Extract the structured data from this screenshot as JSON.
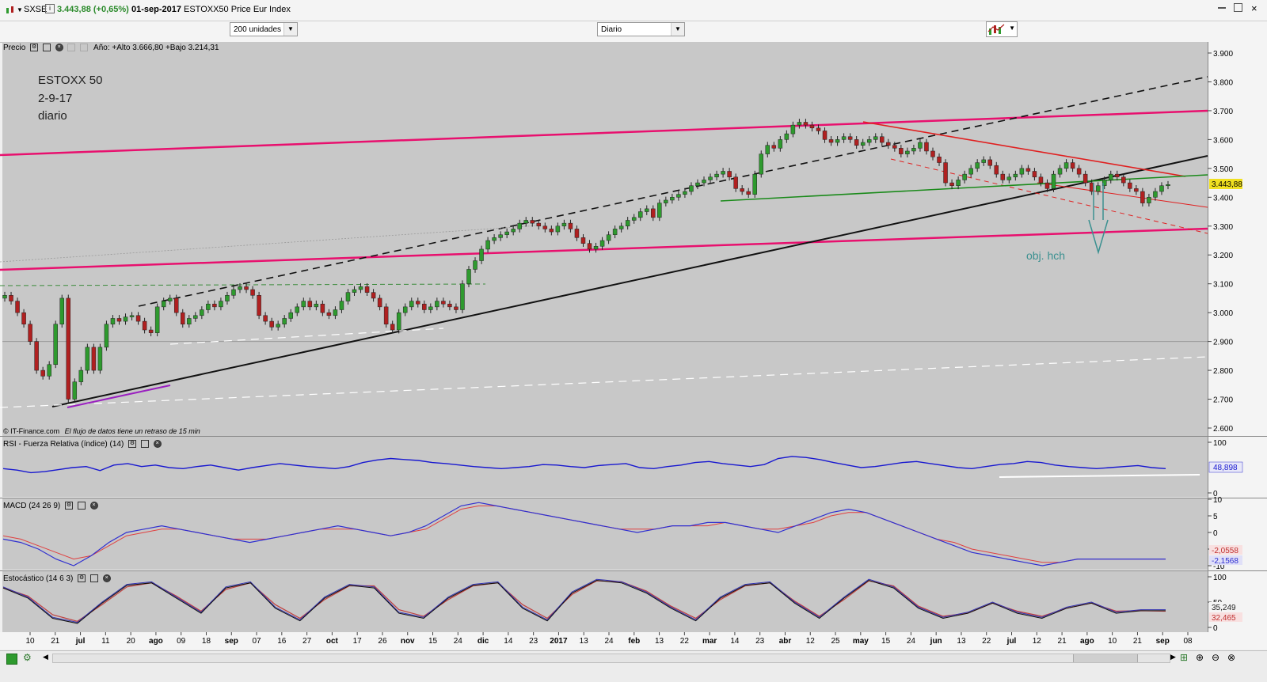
{
  "titlebar": {
    "symbol": "SXSE",
    "price": "3.443,88 (+0,65%)",
    "date": "01-sep-2017",
    "description": "ESTOXX50 Price Eur Index"
  },
  "toolbar": {
    "units_select": "200 unidades",
    "period_select": "Diario"
  },
  "price_panel": {
    "label": "Precio",
    "info": "Año: +Alto 3.666,80 +Bajo 3.214,31",
    "annotation_lines": [
      "ESTOXX 50",
      "2-9-17",
      "diario"
    ],
    "target_label": "obj. hch",
    "current_price": "3.443,88",
    "footer": "© IT-Finance.com",
    "footer_note": "El flujo de datos tiene un retraso de 15 min"
  },
  "rsi_panel": {
    "label": "RSI - Fuerza Relativa (índice) (14)",
    "value": "48,898"
  },
  "macd_panel": {
    "label": "MACD (24 26 9)",
    "value1": "-2,0558",
    "value2": "-2,1568"
  },
  "stoch_panel": {
    "label": "Estocástico (14 6 3)",
    "value1": "35,249",
    "value2": "32,465"
  },
  "colors": {
    "background": "#c8c8c8",
    "up_candle": "#2e9a2e",
    "down_candle": "#b02020",
    "channel": "#e8106e",
    "support": "#1a8a1a",
    "downtrend": "#e02020",
    "rsi": "#1818d0",
    "macd": "#3030d0",
    "signal": "#e04040",
    "target": "#3a9090"
  },
  "chart_data": [
    {
      "type": "line",
      "title": "ESTOXX 50",
      "ylim": [
        2600,
        3900
      ],
      "yticks": [
        "3.900",
        "3.800",
        "3.700",
        "3.600",
        "3.500",
        "3.400",
        "3.300",
        "3.200",
        "3.100",
        "3.000",
        "2.900",
        "2.800",
        "2.700",
        "2.600"
      ],
      "xticks": [
        "10",
        "21",
        "jul",
        "11",
        "20",
        "ago",
        "09",
        "18",
        "sep",
        "07",
        "16",
        "27",
        "oct",
        "17",
        "26",
        "nov",
        "15",
        "24",
        "dic",
        "14",
        "23",
        "2017",
        "13",
        "24",
        "feb",
        "13",
        "22",
        "mar",
        "14",
        "23",
        "abr",
        "12",
        "25",
        "may",
        "15",
        "24",
        "jun",
        "13",
        "22",
        "jul",
        "12",
        "21",
        "ago",
        "10",
        "21",
        "sep",
        "08"
      ],
      "series": [
        {
          "values": [
            3060,
            3040,
            3000,
            2960,
            2900,
            2800,
            2780,
            2820,
            2960,
            3050,
            2700,
            2760,
            2800,
            2880,
            2800,
            2880,
            2960,
            2980,
            2970,
            2985,
            2990,
            2970,
            2940,
            2930,
            3020,
            3040,
            3050,
            3000,
            2960,
            2980,
            2990,
            3010,
            3030,
            3020,
            3040,
            3060,
            3080,
            3090,
            3080,
            3060,
            2990,
            2970,
            2950,
            2960,
            2980,
            3000,
            3020,
            3040,
            3020,
            3030,
            3000,
            2990,
            3010,
            3040,
            3070,
            3080,
            3090,
            3070,
            3050,
            3020,
            2960,
            2940,
            3000,
            3020,
            3040,
            3030,
            3010,
            3020,
            3040,
            3030,
            3020,
            3010,
            3100,
            3150,
            3180,
            3220,
            3250,
            3260,
            3270,
            3280,
            3290,
            3310,
            3320,
            3310,
            3300,
            3290,
            3280,
            3300,
            3310,
            3290,
            3260,
            3240,
            3220,
            3230,
            3250,
            3270,
            3290,
            3300,
            3320,
            3330,
            3350,
            3360,
            3330,
            3380,
            3390,
            3400,
            3410,
            3420,
            3440,
            3450,
            3460,
            3470,
            3480,
            3490,
            3470,
            3430,
            3420,
            3410,
            3480,
            3550,
            3580,
            3570,
            3600,
            3620,
            3650,
            3660,
            3650,
            3640,
            3630,
            3600,
            3590,
            3600,
            3610,
            3600,
            3580,
            3590,
            3600,
            3610,
            3590,
            3580,
            3570,
            3550,
            3560,
            3570,
            3590,
            3560,
            3540,
            3520,
            3450,
            3440,
            3460,
            3480,
            3500,
            3520,
            3530,
            3510,
            3480,
            3460,
            3470,
            3480,
            3500,
            3490,
            3470,
            3450,
            3430,
            3480,
            3500,
            3520,
            3500,
            3480,
            3450,
            3420,
            3440,
            3460,
            3480,
            3470,
            3450,
            3430,
            3420,
            3380,
            3400,
            3420,
            3440,
            3444
          ]
        }
      ],
      "annotations": [
        "obj. hch"
      ]
    },
    {
      "type": "line",
      "title": "RSI - Fuerza Relativa (índice) (14)",
      "ylim": [
        0,
        100
      ],
      "yticks": [
        "100",
        "0"
      ],
      "series": [
        {
          "name": "RSI",
          "values": [
            48,
            45,
            40,
            42,
            46,
            50,
            52,
            44,
            55,
            58,
            52,
            55,
            50,
            48,
            52,
            55,
            50,
            45,
            50,
            54,
            58,
            55,
            52,
            50,
            48,
            52,
            60,
            65,
            68,
            66,
            64,
            60,
            58,
            55,
            52,
            50,
            48,
            50,
            52,
            56,
            55,
            52,
            50,
            54,
            56,
            58,
            50,
            48,
            52,
            55,
            60,
            62,
            58,
            55,
            52,
            56,
            68,
            72,
            70,
            66,
            60,
            55,
            50,
            52,
            56,
            60,
            62,
            58,
            54,
            50,
            48,
            52,
            56,
            58,
            62,
            60,
            55,
            52,
            50,
            48,
            50,
            52,
            54,
            50,
            48
          ]
        }
      ]
    },
    {
      "type": "line",
      "title": "MACD (24 26 9)",
      "ylim": [
        -15,
        12
      ],
      "yticks": [
        "10",
        "5",
        "0",
        "-5",
        "-10"
      ],
      "series": [
        {
          "name": "MACD",
          "values": [
            -2,
            -3,
            -5,
            -8,
            -10,
            -7,
            -3,
            0,
            1,
            2,
            1,
            0,
            -1,
            -2,
            -3,
            -2,
            -1,
            0,
            1,
            2,
            1,
            0,
            -1,
            0,
            2,
            5,
            8,
            9,
            8,
            7,
            6,
            5,
            4,
            3,
            2,
            1,
            0,
            1,
            2,
            2,
            3,
            3,
            2,
            1,
            0,
            2,
            4,
            6,
            7,
            6,
            4,
            2,
            0,
            -2,
            -4,
            -6,
            -7,
            -8,
            -9,
            -10,
            -9,
            -8,
            -8,
            -8,
            -8,
            -8,
            -8
          ]
        },
        {
          "name": "Signal",
          "values": [
            -1,
            -2,
            -4,
            -6,
            -8,
            -7,
            -4,
            -1,
            0,
            1,
            1,
            0,
            -1,
            -2,
            -2,
            -2,
            -1,
            0,
            1,
            1,
            1,
            0,
            -1,
            0,
            1,
            4,
            7,
            8,
            8,
            7,
            6,
            5,
            4,
            3,
            2,
            1,
            1,
            1,
            2,
            2,
            2,
            3,
            2,
            1,
            1,
            2,
            3,
            5,
            6,
            6,
            4,
            2,
            0,
            -2,
            -3,
            -5,
            -6,
            -7,
            -8,
            -9,
            -9,
            -8,
            -8,
            -8,
            -8,
            -8,
            -8
          ]
        }
      ]
    },
    {
      "type": "line",
      "title": "Estocástico (14 6 3)",
      "ylim": [
        0,
        100
      ],
      "yticks": [
        "100",
        "50",
        "0"
      ],
      "series": [
        {
          "name": "%K",
          "values": [
            80,
            60,
            20,
            10,
            50,
            85,
            90,
            60,
            30,
            80,
            90,
            40,
            15,
            60,
            85,
            80,
            30,
            20,
            60,
            85,
            90,
            40,
            15,
            70,
            95,
            90,
            70,
            40,
            15,
            60,
            85,
            90,
            50,
            20,
            60,
            95,
            80,
            40,
            20,
            30,
            50,
            30,
            20,
            40,
            50,
            30,
            35,
            35
          ]
        },
        {
          "name": "%D",
          "values": [
            78,
            62,
            25,
            12,
            45,
            80,
            88,
            62,
            32,
            75,
            88,
            45,
            18,
            55,
            82,
            82,
            35,
            22,
            55,
            82,
            88,
            45,
            18,
            65,
            92,
            90,
            72,
            42,
            18,
            55,
            82,
            88,
            52,
            22,
            55,
            92,
            82,
            42,
            22,
            28,
            48,
            32,
            22,
            38,
            48,
            32,
            33,
            32
          ]
        }
      ]
    }
  ]
}
